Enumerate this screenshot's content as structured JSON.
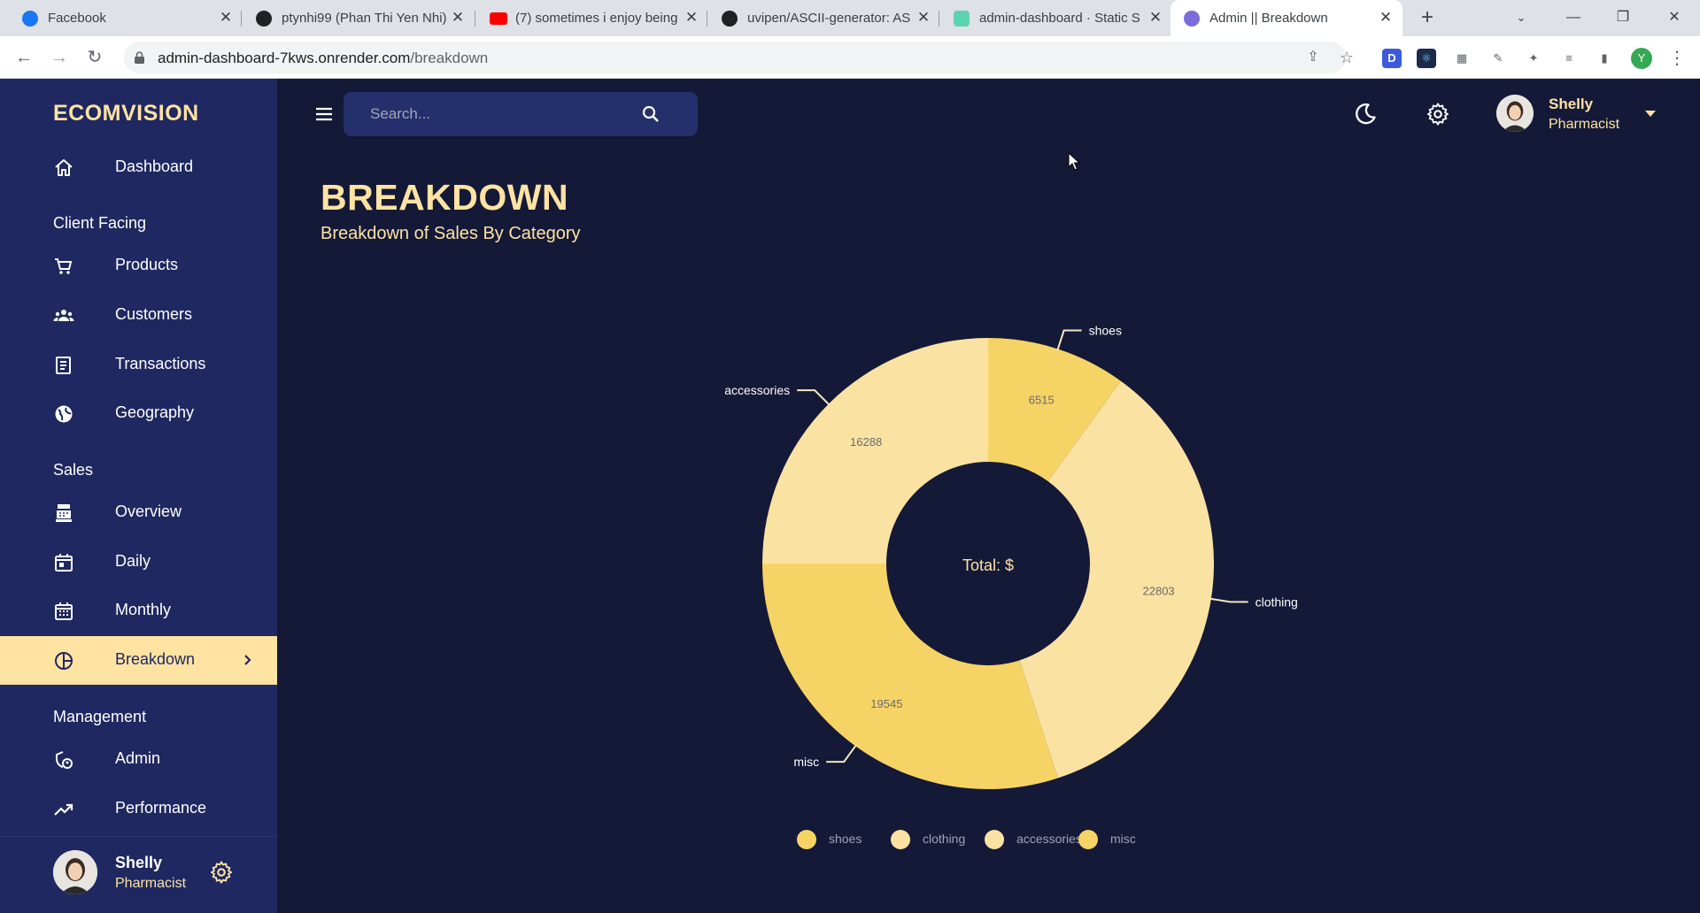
{
  "browser": {
    "tabs": [
      {
        "title": "Facebook",
        "icon": "facebook-icon",
        "color": "#1877f2"
      },
      {
        "title": "ptynhi99 (Phan Thi Yen Nhi)",
        "icon": "github-icon",
        "color": "#202124"
      },
      {
        "title": "(7) sometimes i enjoy being",
        "icon": "youtube-icon",
        "color": "#ff0000"
      },
      {
        "title": "uvipen/ASCII-generator: AS",
        "icon": "github-icon",
        "color": "#202124"
      },
      {
        "title": "admin-dashboard · Static S",
        "icon": "render-icon",
        "color": "#5ed3b0"
      },
      {
        "title": "Admin || Breakdown",
        "icon": "app-icon",
        "color": "#7b6cd9"
      }
    ],
    "url_host": "admin-dashboard-7kws.onrender.com",
    "url_path": "/breakdown",
    "profile_initial": "Y"
  },
  "sidebar": {
    "brand": "ECOMVISION",
    "items": [
      {
        "label": "Dashboard",
        "icon": "home-icon"
      },
      {
        "label": "Products",
        "icon": "shopping-cart-icon"
      },
      {
        "label": "Customers",
        "icon": "groups-icon"
      },
      {
        "label": "Transactions",
        "icon": "receipt-icon"
      },
      {
        "label": "Geography",
        "icon": "globe-icon"
      },
      {
        "label": "Overview",
        "icon": "point-of-sale-icon"
      },
      {
        "label": "Daily",
        "icon": "today-icon"
      },
      {
        "label": "Monthly",
        "icon": "calendar-month-icon"
      },
      {
        "label": "Breakdown",
        "icon": "pie-chart-icon"
      },
      {
        "label": "Admin",
        "icon": "admin-icon"
      },
      {
        "label": "Performance",
        "icon": "trending-up-icon"
      }
    ],
    "sections": [
      "Client Facing",
      "Sales",
      "Management"
    ],
    "active": "Breakdown",
    "user": {
      "name": "Shelly",
      "role": "Pharmacist"
    }
  },
  "topbar": {
    "search_placeholder": "Search...",
    "user": {
      "name": "Shelly",
      "role": "Pharmacist"
    }
  },
  "header": {
    "title": "BREAKDOWN",
    "subtitle": "Breakdown of Sales By Category"
  },
  "chart_data": {
    "type": "pie",
    "donut": true,
    "center_label": "Total: $",
    "categories": [
      "shoes",
      "clothing",
      "misc",
      "accessories"
    ],
    "values": [
      6515,
      22803,
      19545,
      16288
    ],
    "colors": [
      "#f6d365",
      "#fae2a2",
      "#f6d365",
      "#fae2a2"
    ],
    "legend": {
      "placement": "bottom",
      "entries": [
        {
          "label": "shoes",
          "color": "#f6d365"
        },
        {
          "label": "clothing",
          "color": "#fae2a2"
        },
        {
          "label": "accessories",
          "color": "#fae2a2"
        },
        {
          "label": "misc",
          "color": "#f6d365"
        }
      ]
    }
  }
}
